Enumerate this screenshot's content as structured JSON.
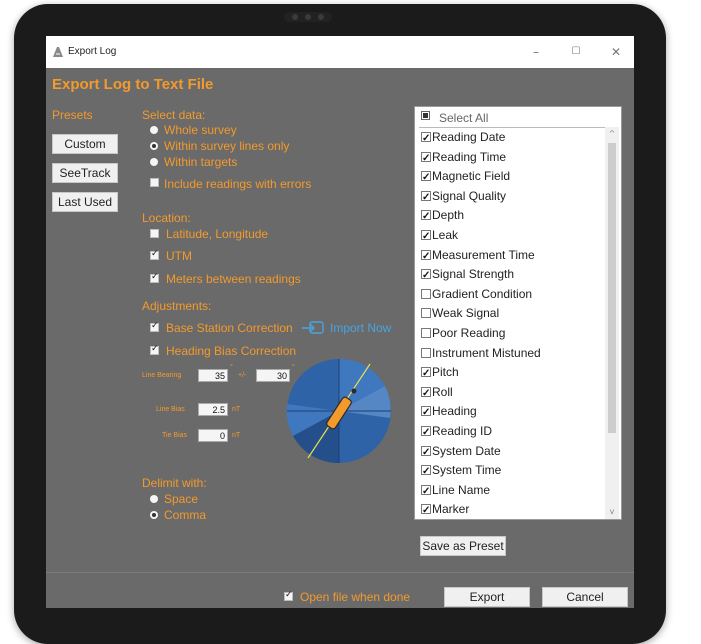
{
  "window": {
    "title": "Export Log",
    "minimize": "–",
    "maximize": "☐",
    "close": "✕"
  },
  "heading": "Export Log to Text File",
  "presets": {
    "label": "Presets",
    "buttons": [
      "Custom",
      "SeeTrack",
      "Last Used"
    ]
  },
  "select_data": {
    "label": "Select data:",
    "options": [
      {
        "label": "Whole survey",
        "selected": false
      },
      {
        "label": "Within survey lines only",
        "selected": true
      },
      {
        "label": "Within targets",
        "selected": false
      }
    ],
    "include_errors": {
      "label": "Include readings with errors",
      "checked": false
    }
  },
  "location": {
    "label": "Location:",
    "items": [
      {
        "label": "Latitude, Longitude",
        "checked": false
      },
      {
        "label": "UTM",
        "checked": true
      },
      {
        "label": "Meters between readings",
        "checked": true
      }
    ]
  },
  "adjustments": {
    "label": "Adjustments:",
    "base_station": {
      "label": "Base Station Correction",
      "checked": true
    },
    "import_now": "Import Now",
    "heading_bias": {
      "label": "Heading Bias Correction",
      "checked": true
    },
    "line_bearing_label": "Line Bearing",
    "line_bearing_value": "35",
    "degree": "°",
    "plusminus": "+/-",
    "tolerance_value": "30",
    "line_bias_label": "Line Bias",
    "line_bias_value": "2.5",
    "tie_bias_label": "Tie Bias",
    "tie_bias_value": "0",
    "unit": "nT"
  },
  "delimit": {
    "label": "Delimit with:",
    "options": [
      {
        "label": "Space",
        "selected": false
      },
      {
        "label": "Comma",
        "selected": true
      }
    ]
  },
  "columns": {
    "select_all": "Select All",
    "items": [
      {
        "label": "Reading Date",
        "checked": true
      },
      {
        "label": "Reading Time",
        "checked": true
      },
      {
        "label": "Magnetic Field",
        "checked": true
      },
      {
        "label": "Signal Quality",
        "checked": true
      },
      {
        "label": "Depth",
        "checked": true
      },
      {
        "label": "Leak",
        "checked": true
      },
      {
        "label": "Measurement Time",
        "checked": true
      },
      {
        "label": "Signal Strength",
        "checked": true
      },
      {
        "label": "Gradient Condition",
        "checked": false
      },
      {
        "label": "Weak Signal",
        "checked": false
      },
      {
        "label": "Poor Reading",
        "checked": false
      },
      {
        "label": "Instrument Mistuned",
        "checked": false
      },
      {
        "label": "Pitch",
        "checked": true
      },
      {
        "label": "Roll",
        "checked": true
      },
      {
        "label": "Heading",
        "checked": true
      },
      {
        "label": "Reading ID",
        "checked": true
      },
      {
        "label": "System Date",
        "checked": true
      },
      {
        "label": "System Time",
        "checked": true
      },
      {
        "label": "Line Name",
        "checked": true
      },
      {
        "label": "Marker",
        "checked": true
      }
    ]
  },
  "save_preset": "Save as Preset",
  "footer": {
    "open_when_done": {
      "label": "Open file when done",
      "checked": true
    },
    "export": "Export",
    "cancel": "Cancel"
  },
  "colors": {
    "accent": "#f39a2c",
    "panel": "#6a6a6a",
    "link": "#4aa3df",
    "dial": "#2e63a8"
  }
}
